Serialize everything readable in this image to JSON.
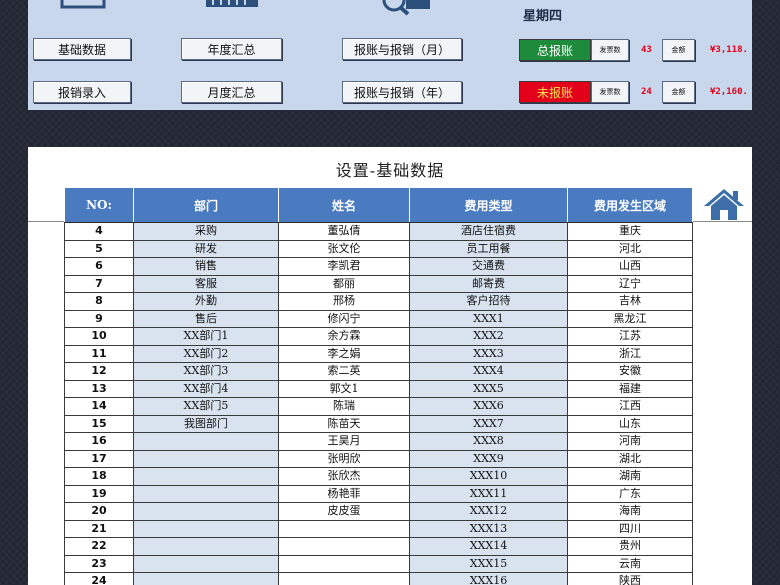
{
  "header": {
    "weekday": "星期四",
    "nav_buttons": [
      {
        "label": "基础数据"
      },
      {
        "label": "年度汇总"
      },
      {
        "label": "报账与报销（月）"
      },
      {
        "label": "报销录入"
      },
      {
        "label": "月度汇总"
      },
      {
        "label": "报账与报销（年）"
      }
    ],
    "summary": [
      {
        "status": "总报账",
        "count_label": "发票数",
        "count": "43",
        "amount_label": "金额",
        "amount": "¥3,118.",
        "color": "#1e8a3c"
      },
      {
        "status": "未报账",
        "count_label": "发票数",
        "count": "24",
        "amount_label": "金额",
        "amount": "¥2,160.",
        "color": "#e2001a"
      }
    ]
  },
  "sheet": {
    "title": "设置-基础数据",
    "columns": [
      "NO:",
      "部门",
      "姓名",
      "费用类型",
      "费用发生区域"
    ],
    "rows": [
      [
        "4",
        "采购",
        "董弘倩",
        "酒店住宿费",
        "重庆"
      ],
      [
        "5",
        "研发",
        "张文伦",
        "员工用餐",
        "河北"
      ],
      [
        "6",
        "销售",
        "李凯君",
        "交通费",
        "山西"
      ],
      [
        "7",
        "客服",
        "都丽",
        "邮寄费",
        "辽宁"
      ],
      [
        "8",
        "外勤",
        "邢杨",
        "客户招待",
        "吉林"
      ],
      [
        "9",
        "售后",
        "修闪宁",
        "XXX1",
        "黑龙江"
      ],
      [
        "10",
        "XX部门1",
        "余方霖",
        "XXX2",
        "江苏"
      ],
      [
        "11",
        "XX部门2",
        "李之娟",
        "XXX3",
        "浙江"
      ],
      [
        "12",
        "XX部门3",
        "索二英",
        "XXX4",
        "安徽"
      ],
      [
        "13",
        "XX部门4",
        "郭文1",
        "XXX5",
        "福建"
      ],
      [
        "14",
        "XX部门5",
        "陈瑞",
        "XXX6",
        "江西"
      ],
      [
        "15",
        "我图部门",
        "陈苗天",
        "XXX7",
        "山东"
      ],
      [
        "16",
        "",
        "王昊月",
        "XXX8",
        "河南"
      ],
      [
        "17",
        "",
        "张明欣",
        "XXX9",
        "湖北"
      ],
      [
        "18",
        "",
        "张欣杰",
        "XXX10",
        "湖南"
      ],
      [
        "19",
        "",
        "杨艳菲",
        "XXX11",
        "广东"
      ],
      [
        "20",
        "",
        "皮皮蛋",
        "XXX12",
        "海南"
      ],
      [
        "21",
        "",
        "",
        "XXX13",
        "四川"
      ],
      [
        "22",
        "",
        "",
        "XXX14",
        "贵州"
      ],
      [
        "23",
        "",
        "",
        "XXX15",
        "云南"
      ],
      [
        "24",
        "",
        "",
        "XXX16",
        "陕西"
      ]
    ]
  },
  "colors": {
    "header_blue": "#4a7ac0",
    "panel_bg": "#c9d7ec",
    "cell_shade": "#d9e3ef"
  },
  "icons": [
    "monitor-icon",
    "bar-chart-icon",
    "search-magnifier-icon",
    "home-icon"
  ]
}
